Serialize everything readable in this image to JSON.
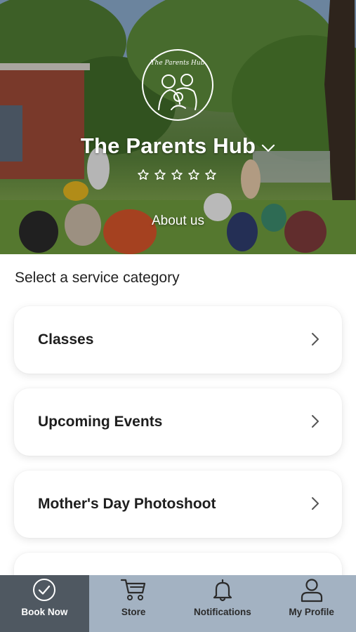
{
  "header": {
    "logo_text": "The Parents Hub",
    "title": "The Parents Hub",
    "rating_stars": 0,
    "rating_max": 5,
    "about_label": "About us"
  },
  "main": {
    "section_label": "Select a service category",
    "categories": [
      {
        "label": "Classes"
      },
      {
        "label": "Upcoming Events"
      },
      {
        "label": "Mother's Day Photoshoot"
      },
      {
        "label": ""
      }
    ]
  },
  "bottom_nav": {
    "items": [
      {
        "label": "Book Now",
        "icon": "check-circle-icon",
        "active": true
      },
      {
        "label": "Store",
        "icon": "cart-icon",
        "active": false
      },
      {
        "label": "Notifications",
        "icon": "bell-icon",
        "active": false
      },
      {
        "label": "My Profile",
        "icon": "user-icon",
        "active": false
      }
    ]
  },
  "colors": {
    "nav_background": "#a3b2c2",
    "nav_active": "#4f5861",
    "card_background": "#ffffff"
  }
}
